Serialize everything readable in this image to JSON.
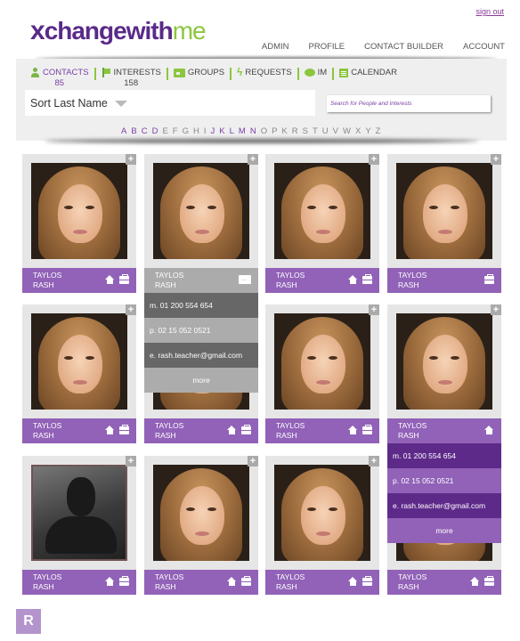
{
  "header": {
    "logo": {
      "x": "x",
      "brand": "changewith",
      "suffix": "me"
    },
    "signout": "sign out",
    "nav": [
      "ADMIN",
      "PROFILE",
      "CONTACT BUILDER",
      "ACCOUNT"
    ]
  },
  "tabs": [
    {
      "label": "CONTACTS",
      "count": "85",
      "icon": "person-icon",
      "active": true
    },
    {
      "label": "INTERESTS",
      "count": "158",
      "icon": "flag-icon",
      "active": false
    },
    {
      "label": "GROUPS",
      "count": "",
      "icon": "folder-icon",
      "active": false
    },
    {
      "label": "REQUESTS",
      "count": "",
      "icon": "bolt-icon",
      "active": false
    },
    {
      "label": "IM",
      "count": "",
      "icon": "chat-bubble-icon",
      "active": false
    },
    {
      "label": "CALENDAR",
      "count": "",
      "icon": "calendar-icon",
      "active": false
    }
  ],
  "sort": {
    "label": "Sort Last Name"
  },
  "search": {
    "placeholder": "Search for People and Interests",
    "value": ""
  },
  "alphabet": {
    "letters": [
      "A",
      "B",
      "C",
      "D",
      "E",
      "F",
      "G",
      "H",
      "I",
      "J",
      "K",
      "L",
      "M",
      "N",
      "O",
      "P",
      "K",
      "R",
      "S",
      "T",
      "U",
      "V",
      "W",
      "X",
      "Y",
      "Z"
    ],
    "active": [
      "A",
      "B",
      "C",
      "D",
      "J",
      "K",
      "L",
      "M",
      "N"
    ]
  },
  "colors": {
    "accent_purple": "#9162b8",
    "dark_purple": "#5e2a8a",
    "brand_green": "#8cc63f",
    "grey_bar": "#ababab"
  },
  "contacts": [
    {
      "first": "TAYLOS",
      "last": "RASH",
      "icons": [
        "home-icon",
        "briefcase-icon"
      ],
      "photo": "face",
      "state": "normal"
    },
    {
      "first": "TAYLOS",
      "last": "RASH",
      "icons": [
        "folder-icon"
      ],
      "photo": "face",
      "state": "expanded-grey"
    },
    {
      "first": "TAYLOS",
      "last": "RASH",
      "icons": [
        "home-icon",
        "briefcase-icon"
      ],
      "photo": "face",
      "state": "normal"
    },
    {
      "first": "TAYLOS",
      "last": "RASH",
      "icons": [
        "briefcase-icon"
      ],
      "photo": "face",
      "state": "normal"
    },
    {
      "first": "TAYLOS",
      "last": "RASH",
      "icons": [
        "home-icon",
        "briefcase-icon"
      ],
      "photo": "face",
      "state": "normal"
    },
    {
      "first": "TAYLOS",
      "last": "RASH",
      "icons": [
        "home-icon",
        "briefcase-icon"
      ],
      "photo": "face",
      "state": "normal"
    },
    {
      "first": "TAYLOS",
      "last": "RASH",
      "icons": [
        "home-icon",
        "briefcase-icon"
      ],
      "photo": "face",
      "state": "normal"
    },
    {
      "first": "TAYLOS",
      "last": "RASH",
      "icons": [
        "home-icon"
      ],
      "photo": "face",
      "state": "expanded-purple"
    },
    {
      "first": "TAYLOS",
      "last": "RASH",
      "icons": [
        "home-icon",
        "briefcase-icon"
      ],
      "photo": "silhouette",
      "state": "normal"
    },
    {
      "first": "TAYLOS",
      "last": "RASH",
      "icons": [
        "home-icon",
        "briefcase-icon"
      ],
      "photo": "face",
      "state": "normal"
    },
    {
      "first": "TAYLOS",
      "last": "RASH",
      "icons": [
        "home-icon",
        "briefcase-icon"
      ],
      "photo": "face",
      "state": "normal"
    },
    {
      "first": "TAYLOS",
      "last": "RASH",
      "icons": [
        "home-icon",
        "briefcase-icon"
      ],
      "photo": "face",
      "state": "normal"
    }
  ],
  "popup_grey": {
    "lines": [
      "m. 01 200 554 654",
      "p. 02 15 052 0521",
      "e. rash.teacher@gmail.com",
      "more"
    ]
  },
  "popup_purple": {
    "lines": [
      "m. 01 200 554 654",
      "p. 02 15 052 0521",
      "e. rash.teacher@gmail.com",
      "more"
    ]
  },
  "badge": "R"
}
